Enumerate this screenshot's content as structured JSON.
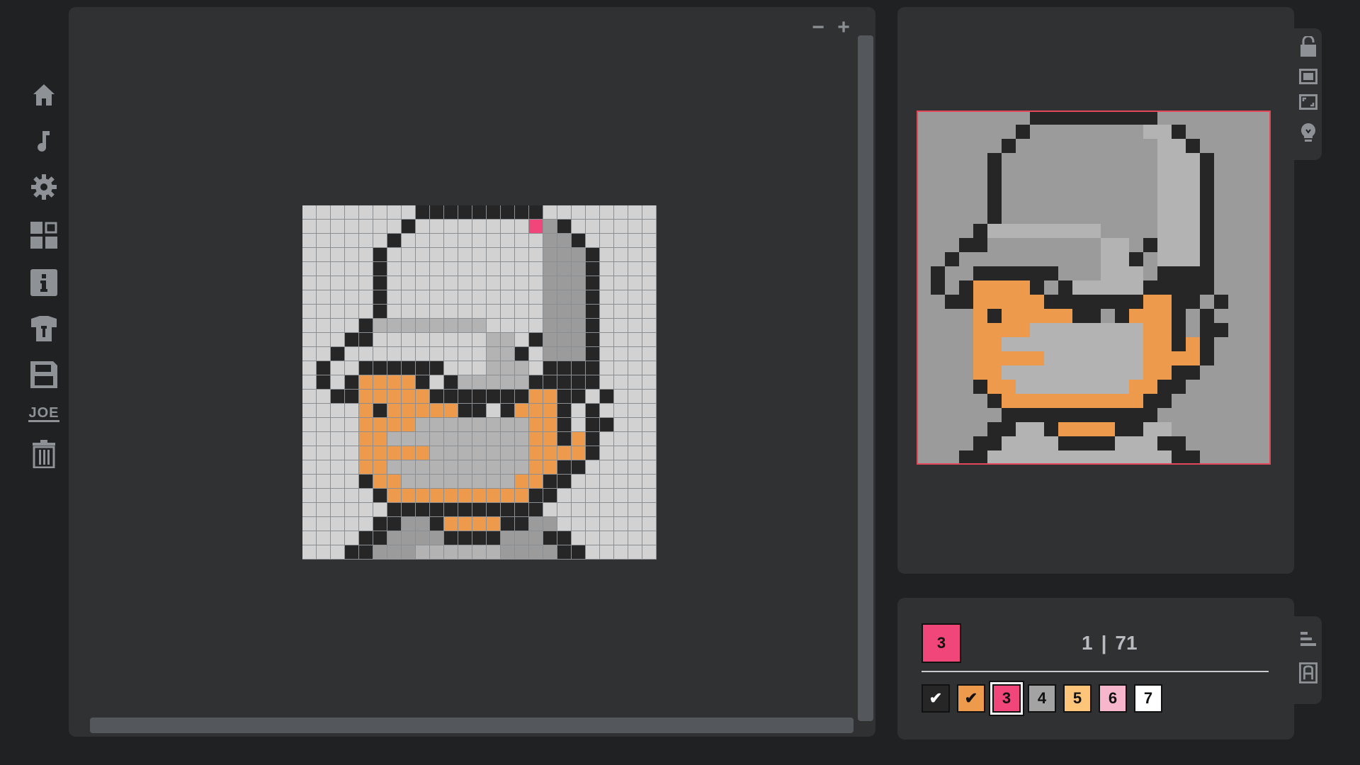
{
  "toolbar": {
    "items": [
      {
        "name": "home-icon"
      },
      {
        "name": "music-icon"
      },
      {
        "name": "gear-icon"
      },
      {
        "name": "layout-icon"
      },
      {
        "name": "info-icon"
      },
      {
        "name": "shirt-icon"
      },
      {
        "name": "save-icon"
      },
      {
        "name": "joe-icon",
        "label": "JOE"
      },
      {
        "name": "trash-icon"
      }
    ]
  },
  "canvas": {
    "zoom_out": "−",
    "zoom_in": "+",
    "selected_color": "#f0467a"
  },
  "preview": {
    "tools": [
      {
        "name": "lock-open-icon"
      },
      {
        "name": "frame-icon"
      },
      {
        "name": "fullscreen-icon"
      },
      {
        "name": "lightbulb-icon"
      }
    ]
  },
  "palette": {
    "current": {
      "label": "3",
      "color": "#f0467a"
    },
    "progress": {
      "current": "1",
      "separator": "|",
      "total": "71"
    },
    "swatches": [
      {
        "label": "✔",
        "color": "#262626",
        "text_color": "#ffffff",
        "selected": false
      },
      {
        "label": "✔",
        "color": "#ee9a4d",
        "text_color": "#111111",
        "selected": false
      },
      {
        "label": "3",
        "color": "#f0467a",
        "text_color": "#111111",
        "selected": true
      },
      {
        "label": "4",
        "color": "#a3a3a3",
        "text_color": "#111111",
        "selected": false
      },
      {
        "label": "5",
        "color": "#fdc57a",
        "text_color": "#111111",
        "selected": false
      },
      {
        "label": "6",
        "color": "#f7b6cc",
        "text_color": "#111111",
        "selected": false
      },
      {
        "label": "7",
        "color": "#ffffff",
        "text_color": "#111111",
        "selected": false
      }
    ],
    "side_tools": [
      {
        "name": "sort-icon"
      },
      {
        "name": "font-icon"
      }
    ]
  },
  "colors": {
    "black": "#262626",
    "orange": "#ee9a4d",
    "pink": "#f0467a",
    "gray_dark": "#9b9b9b",
    "gray_mid": "#b3b3b3",
    "gray_light": "#cdcdcd",
    "bg_empty": "#d2d2d2"
  },
  "pixel_art": {
    "size": 25,
    "rows": [
      "........KKKKKKKKK........",
      ".......K........PHK......",
      "......K..........HHK.....",
      ".....K...........HHHK....",
      ".....K...........HHHK....",
      ".....K...........HHHK....",
      ".....K...........HHHK....",
      ".....K...........HHHK....",
      "....KMMMMMMMM....HHHK....",
      "...KK........MM.KHHHK....",
      "..K..........MMK.HHHK....",
      ".K..KKKKKK...MMM.KKKK....",
      ".K.KOOOOK.KMMMMMKKKKK....",
      "..KKOOOOOKKKKKKKOOKK.K...",
      "....OKOOOOOKK.KOOOK.K....",
      "....OOOOMMMMMMMMOOK.KK...",
      "....OOMMMMMMMMMMOOKOK....",
      "....OOOOOMMMMMMMOOOOK....",
      "....OOMMMMMMMMMMOOKK.....",
      "....KOOMMMMMMMMOOKK......",
      ".....KOOOOOOOOOOKK.......",
      "......KKKKKKKKKKK........",
      ".....KKHHKOOOOKKHH.......",
      "....KKHHHHKKKKHHHKK......",
      "...KKHHHMMMMMMHHHHKK....."
    ]
  }
}
